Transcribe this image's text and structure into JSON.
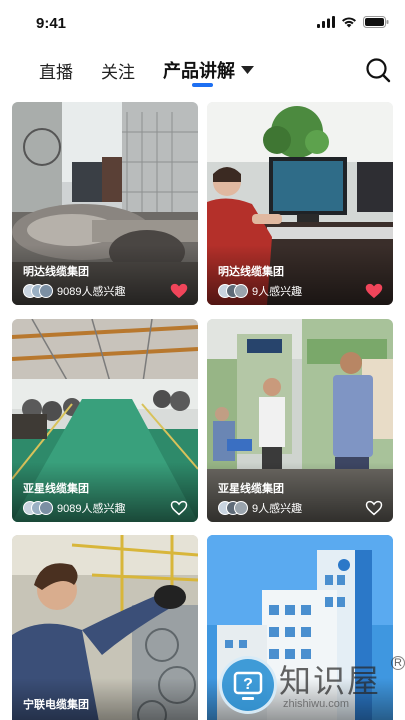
{
  "status_bar": {
    "time": "9:41"
  },
  "nav": {
    "tabs": [
      {
        "label": "直播"
      },
      {
        "label": "关注"
      },
      {
        "label": "产品讲解"
      }
    ],
    "active_tab": "产品讲解",
    "accent_color": "#1d6ff2"
  },
  "cards": [
    {
      "company": "明达线缆集团",
      "interest": "9089人感兴趣",
      "liked": true
    },
    {
      "company": "明达线缆集团",
      "interest": "9人感兴趣",
      "liked": true
    },
    {
      "company": "亚星线缆集团",
      "interest": "9089人感兴趣",
      "liked": false
    },
    {
      "company": "亚星线缆集团",
      "interest": "9人感兴趣",
      "liked": false
    },
    {
      "company": "宁联电缆集团",
      "interest": "",
      "liked": false
    },
    {
      "company": "",
      "interest": "",
      "liked": false
    }
  ],
  "watermark": {
    "text": "知识屋",
    "sub": "zhishiwu.com",
    "reg": "R"
  },
  "colors": {
    "heart_active": "#f0455a",
    "heart_inactive": "#ffffff"
  }
}
